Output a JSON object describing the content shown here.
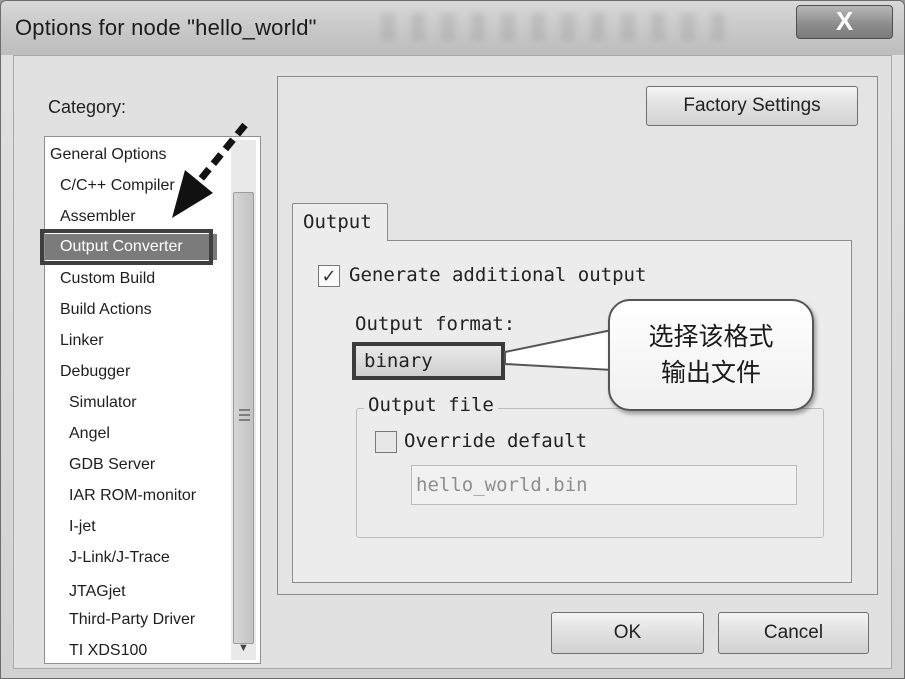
{
  "window": {
    "title": "Options for node \"hello_world\"",
    "close_glyph": "X"
  },
  "category": {
    "label": "Category:",
    "items": [
      {
        "label": "General Options",
        "level": 0
      },
      {
        "label": "C/C++ Compiler",
        "level": 1
      },
      {
        "label": "Assembler",
        "level": 1
      },
      {
        "label": "Output Converter",
        "level": 1,
        "selected": true
      },
      {
        "label": "Custom Build",
        "level": 1
      },
      {
        "label": "Build Actions",
        "level": 1
      },
      {
        "label": "Linker",
        "level": 1
      },
      {
        "label": "Debugger",
        "level": 1
      },
      {
        "label": "Simulator",
        "level": 2
      },
      {
        "label": "Angel",
        "level": 2
      },
      {
        "label": "GDB Server",
        "level": 2
      },
      {
        "label": "IAR ROM-monitor",
        "level": 2
      },
      {
        "label": "I-jet",
        "level": 2
      },
      {
        "label": "J-Link/J-Trace",
        "level": 2
      },
      {
        "label": "JTAGjet",
        "level": 2
      },
      {
        "label": "Third-Party Driver",
        "level": 2
      },
      {
        "label": "TI XDS100",
        "level": 2
      }
    ]
  },
  "factory_settings_label": "Factory Settings",
  "tab": {
    "label": "Output"
  },
  "output": {
    "generate_label": "Generate additional output",
    "generate_checked": true,
    "format_label": "Output format:",
    "format_value": "binary",
    "file_group_title": "Output file",
    "override_label": "Override default",
    "override_checked": false,
    "file_name": "hello_world.bin"
  },
  "callout": {
    "line1": "选择该格式",
    "line2": "输出文件"
  },
  "footer": {
    "ok_label": "OK",
    "cancel_label": "Cancel"
  },
  "colors": {
    "selection": "#7b7b7b",
    "frame": "#3f3f3f"
  }
}
